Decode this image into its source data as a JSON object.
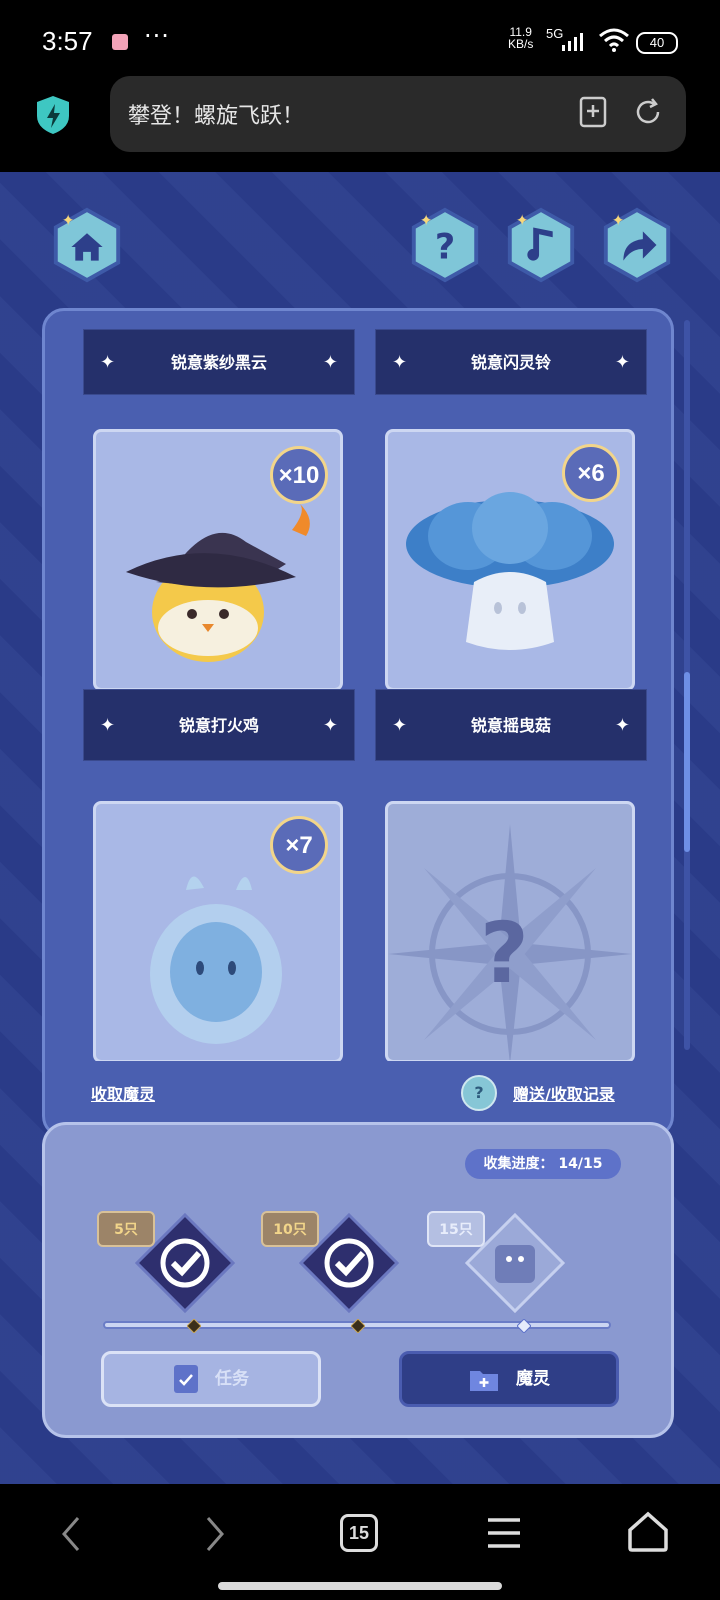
{
  "status_bar": {
    "time": "3:57",
    "more": "···",
    "net_speed_value": "11.9",
    "net_speed_unit": "KB/s",
    "network": "5G",
    "battery": "40"
  },
  "browser": {
    "address_text": "攀登！螺旋飞跃！",
    "shield_color": "#3ec7c2"
  },
  "game": {
    "top_buttons": [
      "home-icon",
      "help-icon",
      "music-icon",
      "share-icon"
    ],
    "top_names": [
      "锐意紫纱黑云",
      "锐意闪灵铃"
    ],
    "cards": [
      {
        "name": "锐意打火鸡",
        "count": "×10"
      },
      {
        "name": "锐意摇曳菇",
        "count": "×6"
      },
      {
        "name": "",
        "count": "×7"
      },
      {
        "name": "",
        "count": "",
        "locked_symbol": "?"
      }
    ],
    "collect_link": "收取魔灵",
    "help_symbol": "?",
    "record_link": "赠送/收取记录",
    "progress_label": "收集进度：",
    "progress_value": "14/15",
    "milestones": [
      {
        "label": "5只",
        "claimed": true
      },
      {
        "label": "10只",
        "claimed": true
      },
      {
        "label": "15只",
        "claimed": false
      }
    ],
    "task_button": "任务",
    "sprite_button": "魔灵"
  },
  "nav": {
    "tabs_count": "15"
  }
}
